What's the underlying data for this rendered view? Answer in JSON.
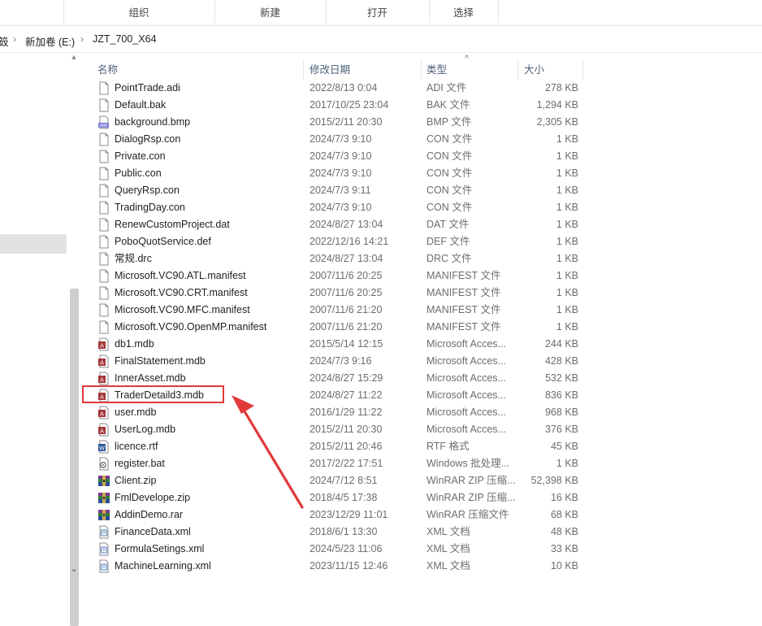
{
  "ribbon": {
    "groups": [
      "组织",
      "新建",
      "打开",
      "选择"
    ]
  },
  "address": {
    "root": "笯",
    "drive": "新加卷 (E:)",
    "folder": "JZT_700_X64"
  },
  "columns": {
    "name": "名称",
    "date": "修改日期",
    "type": "类型",
    "size": "大小"
  },
  "files": [
    {
      "name": "PointTrade.adi",
      "date": "2022/8/13 0:04",
      "type": "ADI 文件",
      "size": "278 KB",
      "icon": "generic-file-icon"
    },
    {
      "name": "Default.bak",
      "date": "2017/10/25 23:04",
      "type": "BAK 文件",
      "size": "1,294 KB",
      "icon": "generic-file-icon"
    },
    {
      "name": "background.bmp",
      "date": "2015/2/11 20:30",
      "type": "BMP 文件",
      "size": "2,305 KB",
      "icon": "bmp-file-icon"
    },
    {
      "name": "DialogRsp.con",
      "date": "2024/7/3 9:10",
      "type": "CON 文件",
      "size": "1 KB",
      "icon": "generic-file-icon"
    },
    {
      "name": "Private.con",
      "date": "2024/7/3 9:10",
      "type": "CON 文件",
      "size": "1 KB",
      "icon": "generic-file-icon"
    },
    {
      "name": "Public.con",
      "date": "2024/7/3 9:10",
      "type": "CON 文件",
      "size": "1 KB",
      "icon": "generic-file-icon"
    },
    {
      "name": "QueryRsp.con",
      "date": "2024/7/3 9:11",
      "type": "CON 文件",
      "size": "1 KB",
      "icon": "generic-file-icon"
    },
    {
      "name": "TradingDay.con",
      "date": "2024/7/3 9:10",
      "type": "CON 文件",
      "size": "1 KB",
      "icon": "generic-file-icon"
    },
    {
      "name": "RenewCustomProject.dat",
      "date": "2024/8/27 13:04",
      "type": "DAT 文件",
      "size": "1 KB",
      "icon": "generic-file-icon"
    },
    {
      "name": "PoboQuotService.def",
      "date": "2022/12/16 14:21",
      "type": "DEF 文件",
      "size": "1 KB",
      "icon": "generic-file-icon"
    },
    {
      "name": "常规.drc",
      "date": "2024/8/27 13:04",
      "type": "DRC 文件",
      "size": "1 KB",
      "icon": "generic-file-icon"
    },
    {
      "name": "Microsoft.VC90.ATL.manifest",
      "date": "2007/11/6 20:25",
      "type": "MANIFEST 文件",
      "size": "1 KB",
      "icon": "generic-file-icon"
    },
    {
      "name": "Microsoft.VC90.CRT.manifest",
      "date": "2007/11/6 20:25",
      "type": "MANIFEST 文件",
      "size": "1 KB",
      "icon": "generic-file-icon"
    },
    {
      "name": "Microsoft.VC90.MFC.manifest",
      "date": "2007/11/6 21:20",
      "type": "MANIFEST 文件",
      "size": "1 KB",
      "icon": "generic-file-icon"
    },
    {
      "name": "Microsoft.VC90.OpenMP.manifest",
      "date": "2007/11/6 21:20",
      "type": "MANIFEST 文件",
      "size": "1 KB",
      "icon": "generic-file-icon"
    },
    {
      "name": "db1.mdb",
      "date": "2015/5/14 12:15",
      "type": "Microsoft Acces...",
      "size": "244 KB",
      "icon": "access-db-icon"
    },
    {
      "name": "FinalStatement.mdb",
      "date": "2024/7/3 9:16",
      "type": "Microsoft Acces...",
      "size": "428 KB",
      "icon": "access-db-icon"
    },
    {
      "name": "InnerAsset.mdb",
      "date": "2024/8/27 15:29",
      "type": "Microsoft Acces...",
      "size": "532 KB",
      "icon": "access-db-icon"
    },
    {
      "name": "TraderDetaild3.mdb",
      "date": "2024/8/27 11:22",
      "type": "Microsoft Acces...",
      "size": "836 KB",
      "icon": "access-db-icon"
    },
    {
      "name": "user.mdb",
      "date": "2016/1/29 11:22",
      "type": "Microsoft Acces...",
      "size": "968 KB",
      "icon": "access-db-icon"
    },
    {
      "name": "UserLog.mdb",
      "date": "2015/2/11 20:30",
      "type": "Microsoft Acces...",
      "size": "376 KB",
      "icon": "access-db-icon"
    },
    {
      "name": "licence.rtf",
      "date": "2015/2/11 20:46",
      "type": "RTF 格式",
      "size": "45 KB",
      "icon": "word-doc-icon"
    },
    {
      "name": "register.bat",
      "date": "2017/2/22 17:51",
      "type": "Windows 批处理...",
      "size": "1 KB",
      "icon": "batch-file-icon"
    },
    {
      "name": "Client.zip",
      "date": "2024/7/12 8:51",
      "type": "WinRAR ZIP 压缩...",
      "size": "52,398 KB",
      "icon": "winrar-archive-icon"
    },
    {
      "name": "FmlDevelope.zip",
      "date": "2018/4/5 17:38",
      "type": "WinRAR ZIP 压缩...",
      "size": "16 KB",
      "icon": "winrar-archive-icon"
    },
    {
      "name": "AddinDemo.rar",
      "date": "2023/12/29 11:01",
      "type": "WinRAR 压缩文件",
      "size": "68 KB",
      "icon": "winrar-archive-icon"
    },
    {
      "name": "FinanceData.xml",
      "date": "2018/6/1 13:30",
      "type": "XML 文档",
      "size": "48 KB",
      "icon": "xml-file-icon"
    },
    {
      "name": "FormulaSetings.xml",
      "date": "2024/5/23 11:06",
      "type": "XML 文档",
      "size": "33 KB",
      "icon": "xml-file-icon"
    },
    {
      "name": "MachineLearning.xml",
      "date": "2023/11/15 12:46",
      "type": "XML 文档",
      "size": "10 KB",
      "icon": "xml-file-icon"
    }
  ],
  "annotation": {
    "highlighted_file": "TraderDetaild3.mdb",
    "color": "#e03a3a"
  }
}
